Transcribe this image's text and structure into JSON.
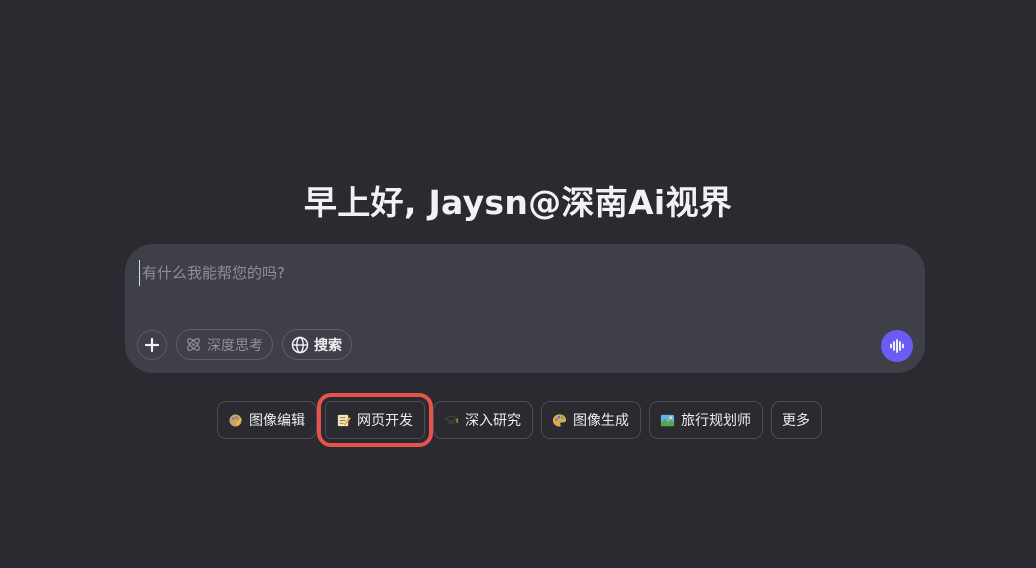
{
  "greeting": "早上好, Jaysn@深南Ai视界",
  "composer": {
    "placeholder": "有什么我能帮您的吗?",
    "value": "",
    "add_icon": "plus-icon",
    "deep_think": {
      "label": "深度思考",
      "icon": "atom-icon",
      "active": false
    },
    "search": {
      "label": "搜索",
      "icon": "globe-icon",
      "active": true
    },
    "voice_icon": "voice-wave-icon"
  },
  "shortcuts": [
    {
      "label": "图像编辑",
      "icon": "palette-pencil-icon"
    },
    {
      "label": "网页开发",
      "icon": "memo-icon",
      "highlighted": true
    },
    {
      "label": "深入研究",
      "icon": "graduation-cap-icon"
    },
    {
      "label": "图像生成",
      "icon": "palette-icon"
    },
    {
      "label": "旅行规划师",
      "icon": "map-icon"
    },
    {
      "label": "更多",
      "icon": ""
    }
  ],
  "colors": {
    "background": "#2a2a30",
    "composer": "#3f3f47",
    "accent": "#6a5cf5",
    "highlight": "#e5534b"
  }
}
